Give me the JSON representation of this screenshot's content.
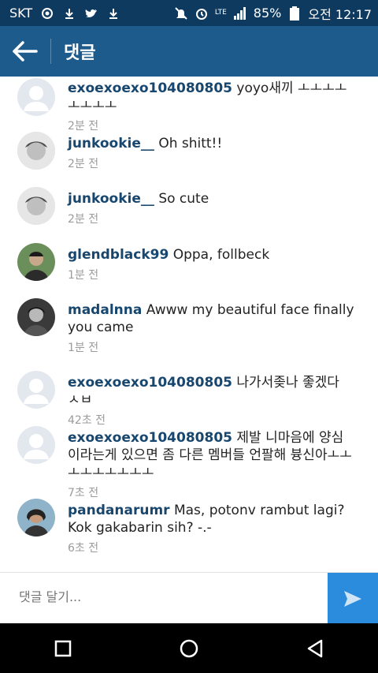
{
  "status": {
    "carrier": "SKT",
    "battery": "85%",
    "time": "오전 12:17",
    "lte": "LTE"
  },
  "header": {
    "title": "댓글"
  },
  "comments": [
    {
      "user": "exoexoexo104080805",
      "text": "yoyo새끼 ㅗㅗㅗㅗㅗㅗㅗㅗ",
      "time": "2분 전"
    },
    {
      "user": "junkookie__",
      "text": "Oh shitt!!",
      "time": "2분 전"
    },
    {
      "user": "junkookie__",
      "text": "So cute",
      "time": "2분 전"
    },
    {
      "user": "glendblack99",
      "text": "Oppa, follbeck",
      "time": "1분 전"
    },
    {
      "user": "madalnna",
      "text": "Awww my beautiful face finally you came",
      "time": "1분 전"
    },
    {
      "user": "exoexoexo104080805",
      "text": "나가서좆나 좋겠다 ㅅㅂ",
      "time": "42초 전"
    },
    {
      "user": "exoexoexo104080805",
      "text": "제발 니마음에 양심이라는게 있으면 좀 다른 멤버들 언팔해 븅신아ㅗㅗㅗㅗㅗㅗㅗㅗㅗ",
      "time": "7초 전"
    },
    {
      "user": "pandanarumr",
      "text": "Mas, potonv rambut lagi? Kok gakabarin sih? -.-",
      "time": "6초 전"
    }
  ],
  "input": {
    "placeholder": "댓글 달기..."
  }
}
